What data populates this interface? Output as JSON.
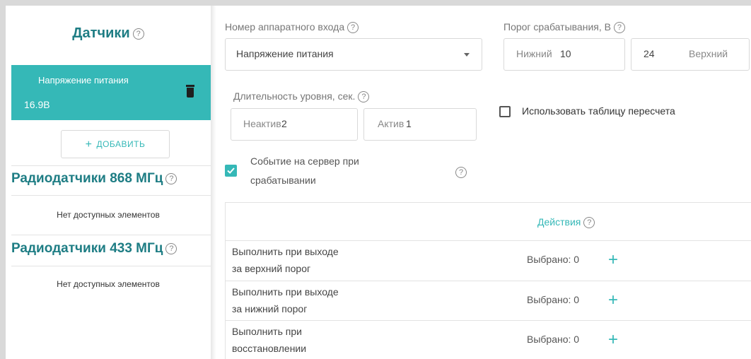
{
  "sidebar": {
    "sensors_title": "Датчики",
    "sensor_item": {
      "name": "Напряжение питания",
      "value": "16.9В"
    },
    "add_button": "ДОБАВИТЬ",
    "radio868": {
      "title": "Радиодатчики 868 МГц",
      "empty": "Нет доступных элементов"
    },
    "radio433": {
      "title": "Радиодатчики 433 МГц",
      "empty": "Нет доступных элементов"
    }
  },
  "form": {
    "hw_input": {
      "label": "Номер аппаратного входа",
      "value": "Напряжение питания"
    },
    "threshold": {
      "label": "Порог срабатывания, В",
      "lower_hint": "Нижний",
      "lower_value": "10",
      "upper_value": "24",
      "upper_hint": "Верхний"
    },
    "duration": {
      "label": "Длительность уровня, сек.",
      "inactive_hint": "Неактив",
      "inactive_value": "2",
      "active_hint": "Актив",
      "active_value": "1"
    },
    "recalc_table": {
      "label": "Использовать таблицу пересчета",
      "checked": false
    },
    "server_event": {
      "label_line1": "Событие на сервер при",
      "label_line2": "срабатывании",
      "checked": true
    }
  },
  "actions": {
    "header": "Действия",
    "rows": [
      {
        "line1": "Выполнить при выходе",
        "line2": "за верхний порог",
        "count": "Выбрано: 0"
      },
      {
        "line1": "Выполнить при выходе",
        "line2": "за нижний порог",
        "count": "Выбрано: 0"
      },
      {
        "line1": "Выполнить при",
        "line2": "восстановлении",
        "count": "Выбрано: 0"
      }
    ]
  },
  "colors": {
    "accent": "#35b8b7",
    "title": "#1e7d84"
  },
  "icons": [
    "help-icon",
    "trash-icon",
    "plus-icon",
    "chevron-down-icon",
    "checkbox-icon"
  ]
}
